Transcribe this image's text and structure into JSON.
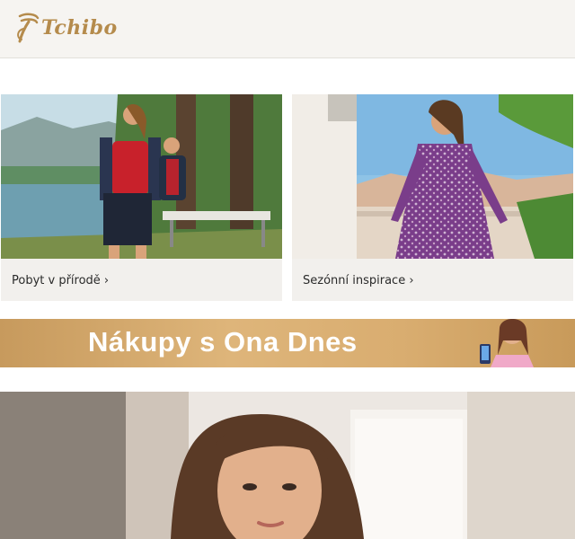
{
  "header": {
    "logo_text": "Tchibo"
  },
  "tiles": [
    {
      "caption": "Pobyt v přírodě ›"
    },
    {
      "caption": "Sezónní inspirace ›"
    }
  ],
  "banner": {
    "text": "Nákupy s Ona Dnes"
  },
  "colors": {
    "brand_gold": "#b58b4c",
    "banner_gold": "#d4a96a"
  }
}
